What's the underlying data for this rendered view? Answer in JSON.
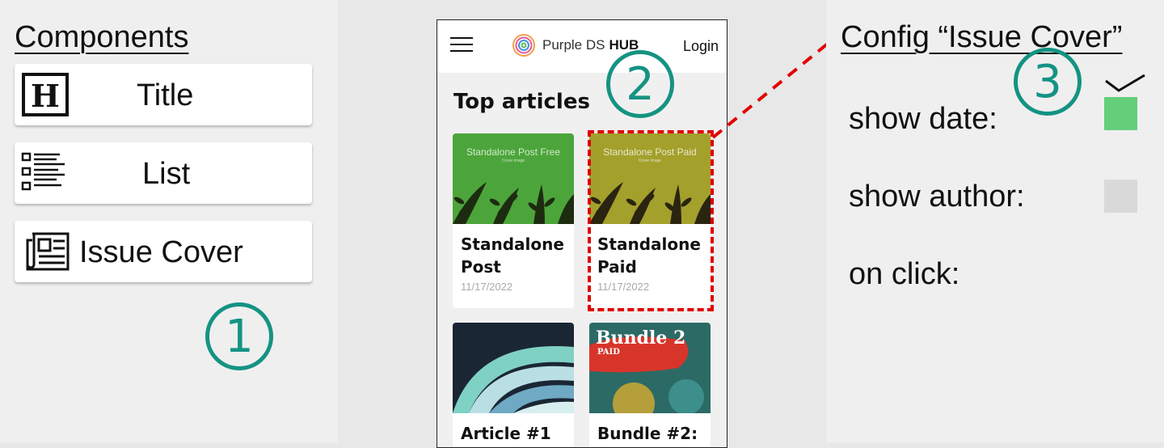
{
  "components_panel": {
    "heading": "Components",
    "items": [
      {
        "label": "Title",
        "icon": "heading-icon"
      },
      {
        "label": "List",
        "icon": "list-icon"
      },
      {
        "label": "Issue Cover",
        "icon": "newspaper-icon"
      }
    ],
    "step_number": "1"
  },
  "preview": {
    "step_number": "2",
    "header": {
      "brand_name": "Purple DS",
      "brand_suffix": "HUB",
      "login_label": "Login"
    },
    "section_title": "Top articles",
    "articles": [
      {
        "title": "Standalone Post",
        "date": "11/17/2022",
        "thumb_label": "Standalone Post Free",
        "thumb_sub": "Cover image",
        "thumb_color": "#4ca53a"
      },
      {
        "title": "Standalone Paid",
        "date": "11/17/2022",
        "thumb_label": "Standalone Post Paid",
        "thumb_sub": "Cover image",
        "thumb_color": "#a3a02c"
      },
      {
        "title": "Article #1",
        "date": "",
        "thumb_label": "",
        "thumb_color": "#1b2634"
      },
      {
        "title": "Bundle #2:",
        "date": "",
        "thumb_label": "Bundle 2",
        "thumb_sub": "PAID",
        "thumb_color": "#2c6a66"
      }
    ]
  },
  "config_panel": {
    "heading": "Config “Issue Cover”",
    "step_number": "3",
    "options": [
      {
        "label": "show date:",
        "checked": true,
        "color": "#63cf7b"
      },
      {
        "label": "show author:",
        "checked": false,
        "color": "#d9d9d9"
      },
      {
        "label": "on click:"
      }
    ]
  },
  "colors": {
    "accent": "#149383",
    "selection": "#e00000"
  }
}
